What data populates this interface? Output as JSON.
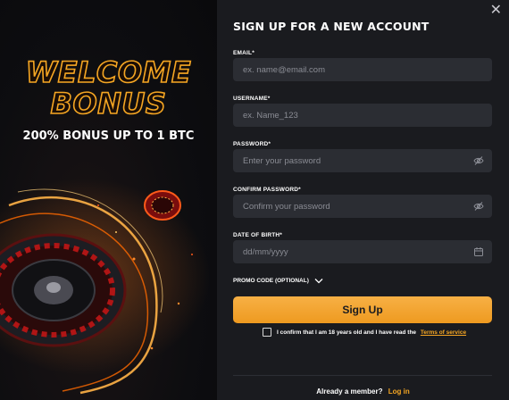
{
  "promo": {
    "welcome_line1": "WELCOME",
    "welcome_line2": "BONUS",
    "offer": "200% BONUS UP TO 1 BTC"
  },
  "form": {
    "title": "SIGN UP FOR A NEW ACCOUNT",
    "close_symbol": "✕",
    "email": {
      "label": "EMAIL*",
      "placeholder": "ex. name@email.com"
    },
    "username": {
      "label": "USERNAME*",
      "placeholder": "ex. Name_123"
    },
    "password": {
      "label": "PASSWORD*",
      "placeholder": "Enter your password",
      "icon": "eye-off-icon"
    },
    "confirm_password": {
      "label": "CONFIRM PASSWORD*",
      "placeholder": "Confirm your password",
      "icon": "eye-off-icon"
    },
    "dob": {
      "label": "DATE OF BIRTH*",
      "placeholder": "dd/mm/yyyy",
      "icon": "calendar-icon"
    },
    "promo_code_label": "PROMO CODE (OPTIONAL)",
    "submit_label": "Sign Up",
    "confirm_text": "I confirm that I am 18 years old and I have read the",
    "terms_link": "Terms of service",
    "member_text": "Already a member?",
    "login_link": "Log in"
  },
  "colors": {
    "accent": "#f5a623",
    "panel_bg": "#1a1b1f",
    "field_bg": "#2b2d33",
    "left_bg": "#0a0a0c"
  }
}
